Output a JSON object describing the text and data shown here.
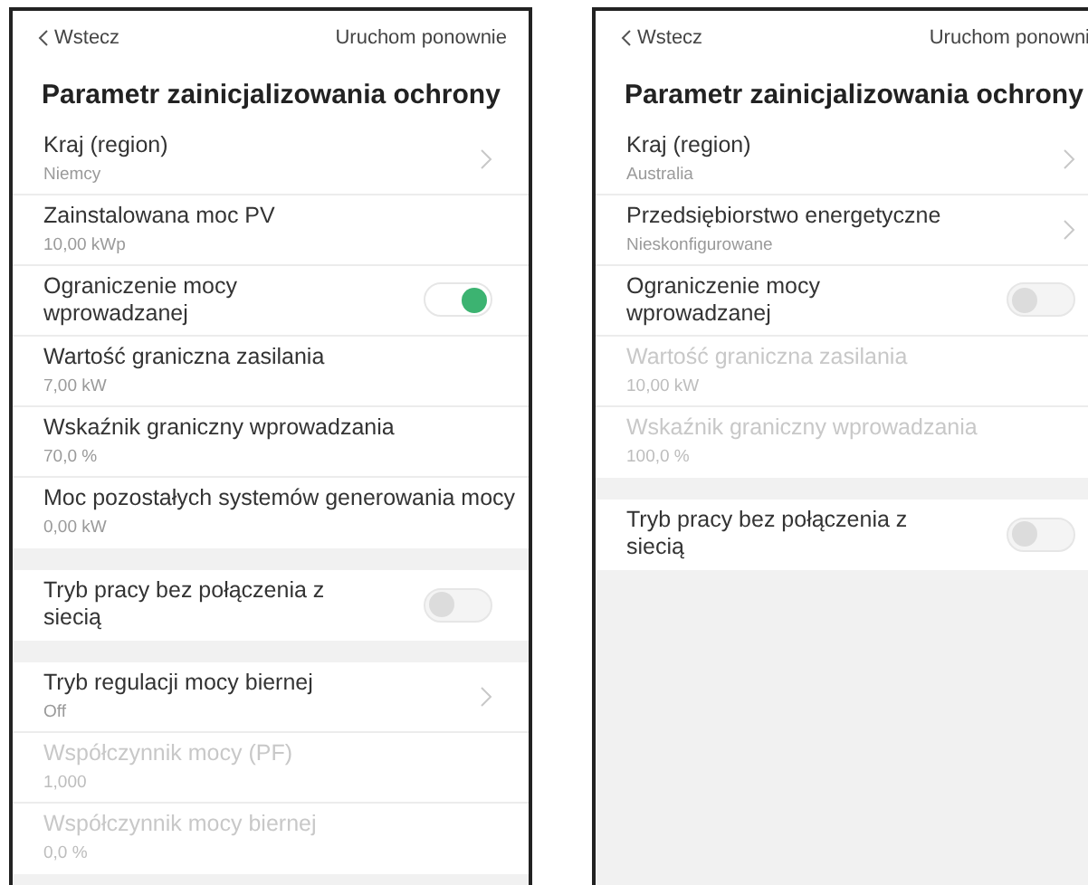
{
  "screens": [
    {
      "back": "Wstecz",
      "restart": "Uruchom ponownie",
      "title": "Parametr zainicjalizowania ochrony",
      "sections": [
        [
          {
            "kind": "nav",
            "label": "Kraj (region)",
            "value": "Niemcy",
            "disabled": false
          },
          {
            "kind": "value",
            "label": "Zainstalowana moc PV",
            "value": "10,00 kWp",
            "disabled": false
          },
          {
            "kind": "toggle",
            "label": "Ograniczenie mocy wprowadzanej",
            "on": true,
            "disabled": false
          },
          {
            "kind": "value",
            "label": "Wartość graniczna zasilania",
            "value": "7,00 kW",
            "disabled": false
          },
          {
            "kind": "value",
            "label": "Wskaźnik graniczny wprowadzania",
            "value": "70,0 %",
            "disabled": false
          },
          {
            "kind": "value",
            "label": "Moc pozostałych systemów generowania mocy",
            "value": "0,00 kW",
            "disabled": false
          }
        ],
        [
          {
            "kind": "toggle",
            "label": "Tryb pracy bez połączenia z siecią",
            "on": false,
            "disabled": false
          }
        ],
        [
          {
            "kind": "nav",
            "label": "Tryb regulacji mocy biernej",
            "value": "Off",
            "disabled": false
          },
          {
            "kind": "value",
            "label": "Współczynnik mocy (PF)",
            "value": "1,000",
            "disabled": true
          },
          {
            "kind": "value",
            "label": "Współczynnik mocy biernej",
            "value": "0,0 %",
            "disabled": true
          }
        ]
      ]
    },
    {
      "back": "Wstecz",
      "restart": "Uruchom ponowni",
      "title": "Parametr zainicjalizowania ochrony",
      "sections": [
        [
          {
            "kind": "nav",
            "label": "Kraj (region)",
            "value": "Australia",
            "disabled": false
          },
          {
            "kind": "nav",
            "label": "Przedsiębiorstwo energetyczne",
            "value": "Nieskonfigurowane",
            "disabled": false
          },
          {
            "kind": "toggle",
            "label": "Ograniczenie mocy wprowadzanej",
            "on": false,
            "disabled": false
          },
          {
            "kind": "value",
            "label": "Wartość graniczna zasilania",
            "value": "10,00 kW",
            "disabled": true
          },
          {
            "kind": "value",
            "label": "Wskaźnik graniczny wprowadzania",
            "value": "100,0 %",
            "disabled": true
          }
        ],
        [
          {
            "kind": "toggle",
            "label": "Tryb pracy bez połączenia z siecią",
            "on": false,
            "disabled": false
          }
        ]
      ]
    }
  ]
}
